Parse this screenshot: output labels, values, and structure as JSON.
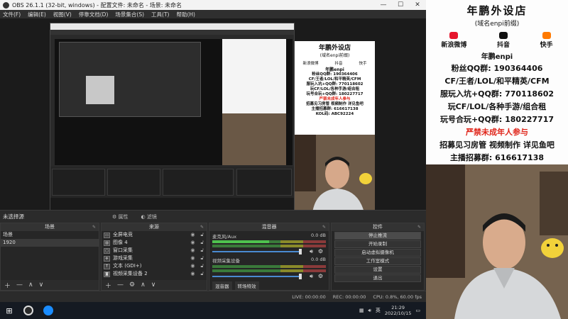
{
  "obs": {
    "title": "OBS 26.1.1 (32-bit, windows) - 配置文件: 未命名 - 场景: 未命名",
    "menu": [
      "文件(F)",
      "编辑(E)",
      "视图(V)",
      "停靠文档(D)",
      "场景集合(S)",
      "工具(T)",
      "帮助(H)"
    ],
    "no_source_selected": "未选择源",
    "props_button": "属性",
    "filters_button": "滤镜"
  },
  "scenes": {
    "header": "场景",
    "items": [
      "场景",
      "1920"
    ]
  },
  "sources": {
    "header": "来源",
    "items": [
      {
        "icon": "monitor-icon",
        "label": "全屏电竞"
      },
      {
        "icon": "image-icon",
        "label": "图像 4"
      },
      {
        "icon": "window-icon",
        "label": "窗口采集"
      },
      {
        "icon": "game-icon",
        "label": "游戏采集"
      },
      {
        "icon": "text-icon",
        "label": "文本 (GDI+)"
      },
      {
        "icon": "camera-icon",
        "label": "视频采集设备 2"
      }
    ]
  },
  "mixer": {
    "header": "混音器",
    "channels": [
      {
        "name": "麦克风/Aux",
        "db": "0.0 dB"
      },
      {
        "name": "视频采集设备",
        "db": "0.0 dB"
      }
    ],
    "tabs": [
      "混音器",
      "转场特效"
    ]
  },
  "controls": {
    "header": "控件",
    "buttons": [
      "停止推流",
      "开始录制",
      "启动虚拟摄像机",
      "工作室模式",
      "设置",
      "退出"
    ]
  },
  "statusbar": {
    "live": "LIVE: 00:00:00",
    "rec": "REC: 00:00:00",
    "cpu": "CPU: 0.8%, 60.00 fps"
  },
  "taskbar": {
    "time": "21:29",
    "date": "2022/10/15",
    "lang": "英"
  },
  "streamer": {
    "title": "年鹏外设店",
    "subtitle": "(域名enpi前缀)",
    "socials": [
      {
        "label": "新浪微博",
        "color": "#e6162d"
      },
      {
        "label": "抖音",
        "color": "#111111"
      },
      {
        "label": "快手",
        "color": "#ff7a00"
      }
    ],
    "handle": "年鹏enpi",
    "lines": [
      {
        "text": "粉丝QQ群: 190364406",
        "red": false
      },
      {
        "text": "CF/王者/LOL/和平精英/CFM",
        "red": false
      },
      {
        "text": "服玩入坑+QQ群: 770118602",
        "red": false
      },
      {
        "text": "玩CF/LOL/各种手游/组合租",
        "red": false
      },
      {
        "text": "玩号合玩+QQ群: 180227717",
        "red": false
      },
      {
        "text": "严禁未成年人参与",
        "red": true
      },
      {
        "text": "招募见习房管 视频制作 详见鱼吧",
        "red": false
      },
      {
        "text": "主播招募群: 616617138",
        "red": false
      },
      {
        "text": "KOL码: ABC92224",
        "red": false
      }
    ]
  }
}
